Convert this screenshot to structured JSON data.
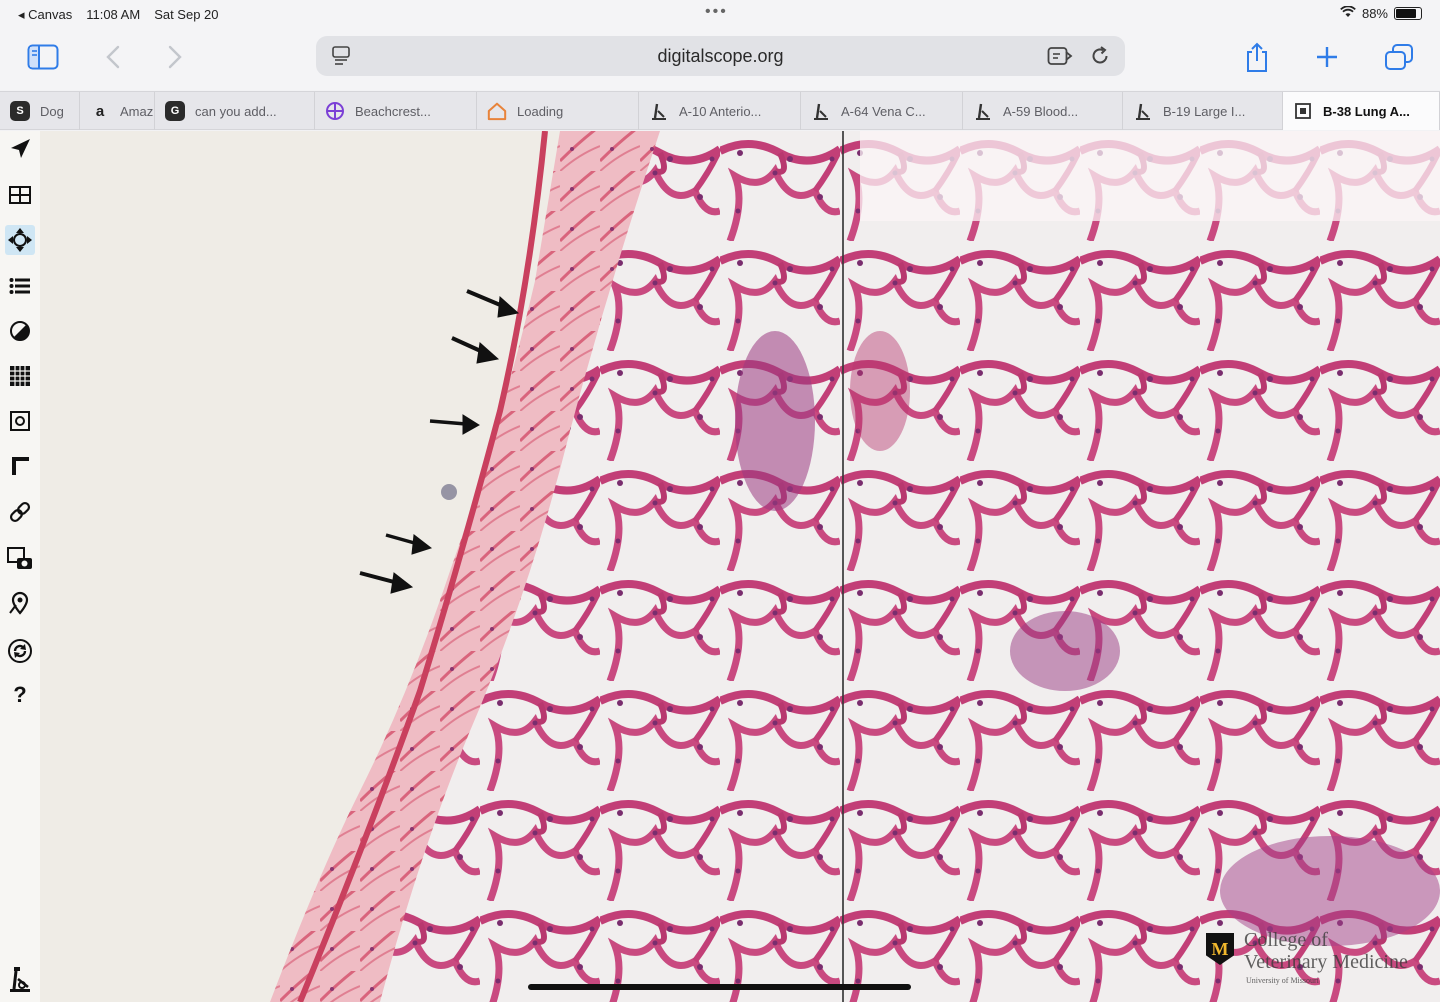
{
  "status_bar": {
    "app_back": "◂ Canvas",
    "time": "11:08 AM",
    "date": "Sat Sep 20",
    "dots": "•••",
    "battery": "88%",
    "battery_fraction": 0.88
  },
  "toolbar": {
    "url": "digitalscope.org"
  },
  "tabs": [
    {
      "label": "Dog",
      "favicon": "S",
      "favicon_style": "dark"
    },
    {
      "label": "Amaz",
      "favicon": "a",
      "favicon_style": "plain"
    },
    {
      "label": "can you add...",
      "favicon": "G",
      "favicon_style": "dark"
    },
    {
      "label": "Beachcrest...",
      "favicon": "globe-icon",
      "favicon_style": "icon"
    },
    {
      "label": "Loading",
      "favicon": "home-icon",
      "favicon_style": "icon"
    },
    {
      "label": "A-10 Anterio...",
      "favicon": "microscope-icon",
      "favicon_style": "icon"
    },
    {
      "label": "A-64 Vena C...",
      "favicon": "microscope-icon",
      "favicon_style": "icon"
    },
    {
      "label": "A-59 Blood...",
      "favicon": "microscope-icon",
      "favicon_style": "icon"
    },
    {
      "label": "B-19 Large I...",
      "favicon": "microscope-icon",
      "favicon_style": "icon"
    },
    {
      "label": "B-38 Lung A...",
      "favicon": "slide-icon",
      "favicon_style": "icon",
      "active": true
    }
  ],
  "viewer_tools": [
    "navigate-icon",
    "layout-icon",
    "pan-zoom-icon",
    "list-icon",
    "contrast-icon",
    "grid-icon",
    "focus-icon",
    "corner-icon",
    "link-icon",
    "snapshot-icon",
    "pin-icon",
    "sync-icon",
    "help-icon",
    "microscope-icon"
  ],
  "logo": {
    "line1": "College of",
    "line2": "Veterinary Medicine",
    "line3": "University of Missouri",
    "monogram": "M"
  },
  "colors": {
    "accent": "#2f7ce8",
    "tissue_pink": "#c8477a",
    "background": "#efece6"
  }
}
